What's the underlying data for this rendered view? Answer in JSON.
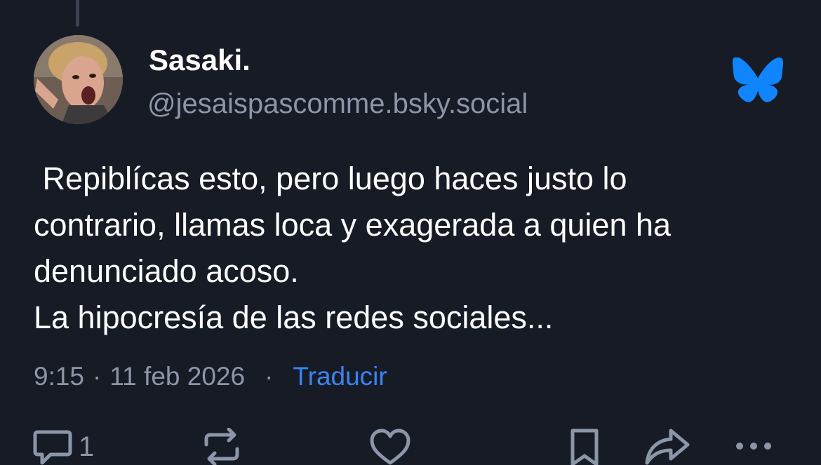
{
  "author": {
    "display_name": "Sasaki.",
    "handle": "@jesaispascomme.bsky.social"
  },
  "post": {
    "text": " Repiblícas esto, pero luego haces justo lo\ncontrario, llamas loca y exagerada a quien ha\ndenunciado acoso.\nLa hipocresía de las redes sociales...",
    "time": "9:15",
    "date": "11 feb 2026",
    "dot": "·",
    "translate_label": "Traducir"
  },
  "actions": {
    "reply_count": "1"
  },
  "icons": {
    "logo": "bluesky-butterfly-icon",
    "reply": "speech-bubble-icon",
    "repost": "repost-arrows-icon",
    "like": "heart-icon",
    "bookmark": "bookmark-icon",
    "share": "share-arrow-icon",
    "more": "ellipsis-icon"
  },
  "colors": {
    "background": "#161b26",
    "accent": "#3b83f6",
    "secondary_text": "#8b97a8",
    "primary_text": "#ffffff"
  }
}
